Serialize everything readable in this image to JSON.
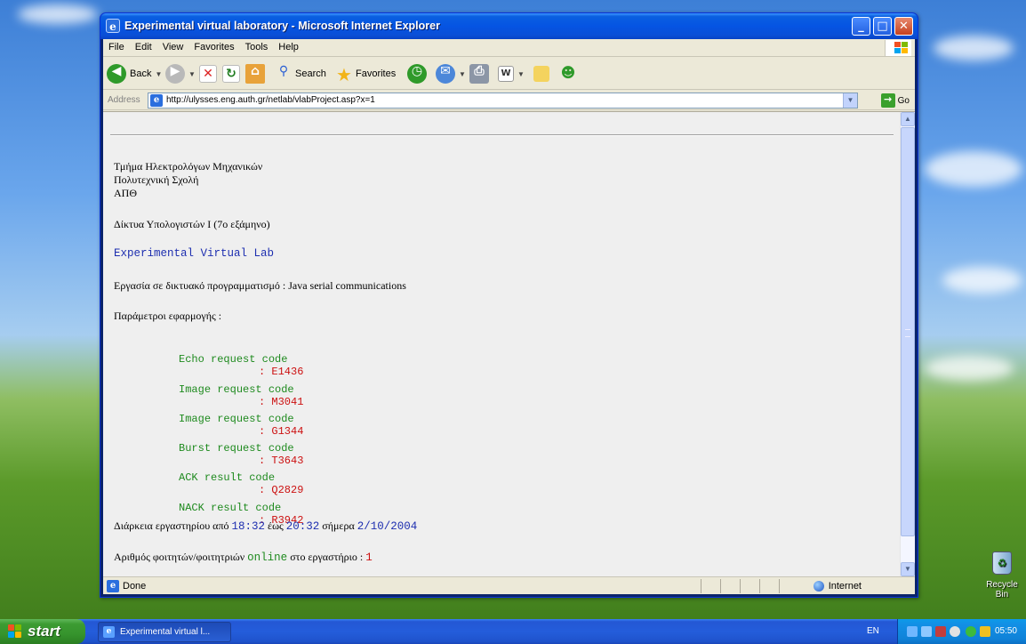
{
  "window": {
    "title": "Experimental virtual laboratory - Microsoft Internet Explorer"
  },
  "menu": [
    "File",
    "Edit",
    "View",
    "Favorites",
    "Tools",
    "Help"
  ],
  "toolbar": {
    "back_label": "Back",
    "search_label": "Search",
    "favorites_label": "Favorites"
  },
  "address": {
    "label": "Address",
    "url": "http://ulysses.eng.auth.gr/netlab/vlabProject.asp?x=1",
    "go_label": "Go"
  },
  "page": {
    "dept_line1": "Τμήμα Ηλεκτρολόγων Μηχανικών",
    "dept_line2": "Πολυτεχνική Σχολή",
    "dept_line3": "ΑΠΘ",
    "course": "Δίκτυα Υπολογιστών Ι (7ο εξάμηνο)",
    "lab_title": "Experimental Virtual Lab",
    "assignment": "Εργασία σε δικτυακό προγραμματισμό : Java serial communications",
    "params_heading": "Παράμετροι εφαρμογής :",
    "params": [
      {
        "label": "Echo request code",
        "value": ": E1436"
      },
      {
        "label": "Image request code",
        "value": ": M3041"
      },
      {
        "label": "Image request code",
        "value": ": G1344"
      },
      {
        "label": "Burst request code",
        "value": ": T3643"
      },
      {
        "label": "ACK result code",
        "value": ": Q2829"
      },
      {
        "label": "NACK result code",
        "value": ": R3942"
      }
    ],
    "duration": {
      "prefix": "Διάρκεια εργαστηρίου από",
      "start": "18:32",
      "mid": "έως",
      "end": "20:32",
      "today_label": "σήμερα",
      "date": "2/10/2004"
    },
    "students": {
      "prefix": "Αριθμός φοιτητών/φοιτητριών",
      "online": "online",
      "suffix": "στο εργαστήριο :",
      "count": "1"
    }
  },
  "status": {
    "text": "Done",
    "zone": "Internet"
  },
  "desktop": {
    "recycle_bin": "Recycle Bin"
  },
  "taskbar": {
    "start_label": "start",
    "task_label": "Experimental virtual l...",
    "language": "EN",
    "clock": "05:50"
  },
  "colors": {
    "lab_title": "#1e2fb0",
    "param_label": "#1e8a1e",
    "param_value": "#cc1010"
  },
  "icons": [
    "ie-icon",
    "minimize-icon",
    "maximize-icon",
    "close-icon",
    "back-icon",
    "forward-icon",
    "stop-icon",
    "refresh-icon",
    "home-icon",
    "search-icon",
    "favorites-star-icon",
    "history-icon",
    "mail-icon",
    "print-icon",
    "edit-icon",
    "folder-icon",
    "messenger-icon",
    "go-arrow-icon",
    "globe-icon",
    "recycle-bin-icon",
    "windows-logo-icon"
  ]
}
